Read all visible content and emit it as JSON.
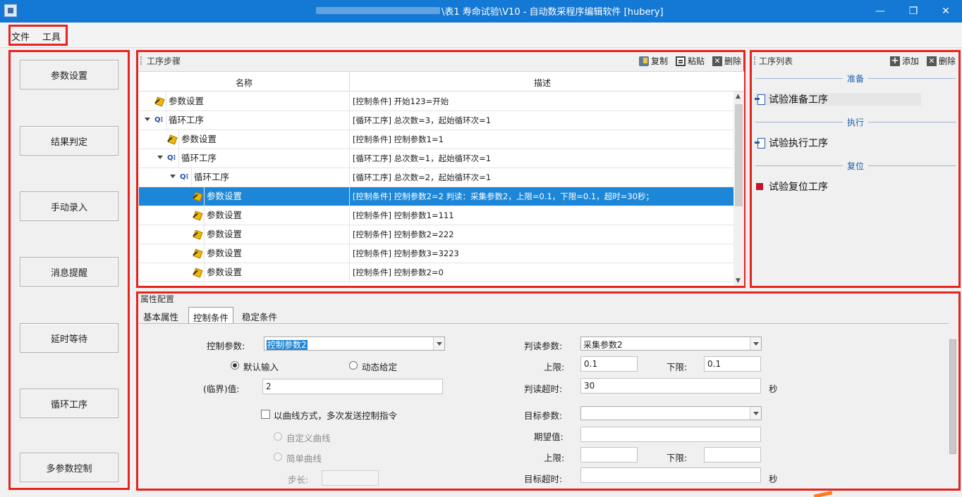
{
  "window": {
    "title": "\\表1 寿命试验\\V10  - 自动数采程序编辑软件 [hubery]",
    "minimize_glyph": "—",
    "restore_glyph": "❐",
    "close_glyph": "✕"
  },
  "menu": {
    "items": [
      "文件",
      "工具"
    ]
  },
  "left_buttons": [
    "参数设置",
    "结果判定",
    "手动录入",
    "消息提醒",
    "延时等待",
    "循环工序",
    "多参数控制"
  ],
  "steps_panel": {
    "title": "工序步骤",
    "toolbar": {
      "copy": "复制",
      "paste": "粘贴",
      "delete": "删除"
    },
    "columns": {
      "name": "名称",
      "desc": "描述"
    },
    "rows": [
      {
        "name": "参数设置",
        "desc": "[控制条件] 开始123=开始",
        "type": "param",
        "level": 0,
        "selected": false
      },
      {
        "name": "循环工序",
        "desc": "[循环工序] 总次数=3，起始循环次=1",
        "type": "loop",
        "level": 0,
        "selected": false
      },
      {
        "name": "参数设置",
        "desc": "[控制条件] 控制参数1=1",
        "type": "param",
        "level": 1,
        "selected": false
      },
      {
        "name": "循环工序",
        "desc": "[循环工序] 总次数=1，起始循环次=1",
        "type": "loop",
        "level": 1,
        "selected": false
      },
      {
        "name": "循环工序",
        "desc": "[循环工序] 总次数=2，起始循环次=1",
        "type": "loop",
        "level": 2,
        "selected": false
      },
      {
        "name": "参数设置",
        "desc": "[控制条件] 控制参数2=2    判读：采集参数2，上限=0.1，下限=0.1，超时=30秒；",
        "type": "param",
        "level": 3,
        "selected": true
      },
      {
        "name": "参数设置",
        "desc": "[控制条件] 控制参数1=111",
        "type": "param",
        "level": 3,
        "selected": false
      },
      {
        "name": "参数设置",
        "desc": "[控制条件] 控制参数2=222",
        "type": "param",
        "level": 3,
        "selected": false
      },
      {
        "name": "参数设置",
        "desc": "[控制条件] 控制参数3=3223",
        "type": "param",
        "level": 3,
        "selected": false
      },
      {
        "name": "参数设置",
        "desc": "[控制条件] 控制参数2=0",
        "type": "param",
        "level": 3,
        "selected": false
      }
    ]
  },
  "ops_panel": {
    "title": "工序列表",
    "toolbar": {
      "add": "添加",
      "delete": "删除"
    },
    "groups": [
      {
        "header": "准备",
        "item": "试验准备工序"
      },
      {
        "header": "执行",
        "item": "试验执行工序"
      },
      {
        "header": "复位",
        "item": "试验复位工序"
      }
    ]
  },
  "props": {
    "title": "属性配置",
    "tabs": [
      "基本属性",
      "控制条件",
      "稳定条件"
    ],
    "active_tab": "控制条件",
    "control_param_label": "控制参数:",
    "control_param_value": "控制参数2",
    "radio_default": "默认输入",
    "radio_dynamic": "动态给定",
    "threshold_label": "(临界)值:",
    "threshold_value": "2",
    "curve_checkbox": "以曲线方式，多次发送控制指令",
    "custom_curve": "自定义曲线",
    "simple_curve": "简单曲线",
    "step_label": "步长:",
    "step_value": "",
    "read_param_label": "判读参数:",
    "read_param_value": "采集参数2",
    "upper_label": "上限:",
    "upper_value": "0.1",
    "lower_label": "下限:",
    "lower_value": "0.1",
    "timeout_label": "判读超时:",
    "timeout_value": "30",
    "sec_unit": "秒",
    "target_param_label": "目标参数:",
    "target_param_value": "",
    "expected_label": "期望值:",
    "expected_value": "",
    "target_upper_label": "上限:",
    "target_upper_value": "",
    "target_lower_label": "下限:",
    "target_lower_value": "",
    "target_timeout_label": "目标超时:",
    "target_timeout_value": "",
    "target_sec_unit": "秒"
  },
  "colors": {
    "annotation": "#e52420",
    "title_bar": "#1479d4",
    "selection": "#1c86d8"
  }
}
